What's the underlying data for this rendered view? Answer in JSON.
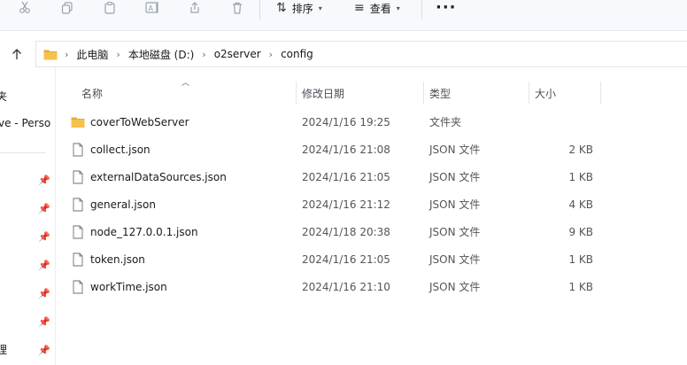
{
  "toolbar": {
    "sort_label": "排序",
    "view_label": "查看",
    "more_label": "···"
  },
  "address": {
    "crumbs": [
      "此电脑",
      "本地磁盘 (D:)",
      "o2server",
      "config"
    ]
  },
  "sidebar": {
    "texts": [
      "夹",
      "ve - Perso",
      "理"
    ]
  },
  "columns": {
    "name": "名称",
    "modified": "修改日期",
    "type": "类型",
    "size": "大小"
  },
  "files": [
    {
      "name": "coverToWebServer",
      "modified": "2024/1/16 19:25",
      "type": "文件夹",
      "size": "",
      "kind": "folder"
    },
    {
      "name": "collect.json",
      "modified": "2024/1/16 21:08",
      "type": "JSON 文件",
      "size": "2 KB",
      "kind": "file"
    },
    {
      "name": "externalDataSources.json",
      "modified": "2024/1/16 21:05",
      "type": "JSON 文件",
      "size": "1 KB",
      "kind": "file"
    },
    {
      "name": "general.json",
      "modified": "2024/1/16 21:12",
      "type": "JSON 文件",
      "size": "4 KB",
      "kind": "file"
    },
    {
      "name": "node_127.0.0.1.json",
      "modified": "2024/1/18 20:38",
      "type": "JSON 文件",
      "size": "9 KB",
      "kind": "file"
    },
    {
      "name": "token.json",
      "modified": "2024/1/16 21:05",
      "type": "JSON 文件",
      "size": "1 KB",
      "kind": "file"
    },
    {
      "name": "workTime.json",
      "modified": "2024/1/16 21:10",
      "type": "JSON 文件",
      "size": "1 KB",
      "kind": "file"
    }
  ],
  "colors": {
    "folder": "#f4c24d",
    "folder_dark": "#e5ac28"
  }
}
